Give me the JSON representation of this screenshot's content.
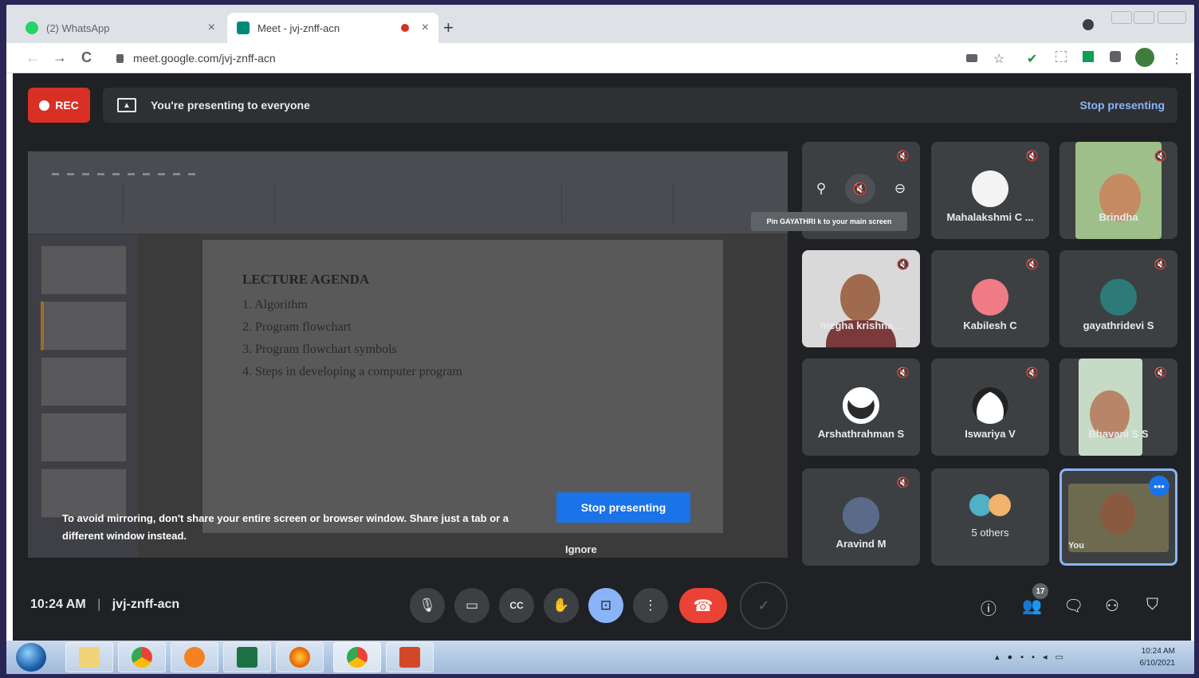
{
  "browser": {
    "tabs": [
      {
        "title": "(2) WhatsApp",
        "active": false,
        "favicon_color": "#25d366"
      },
      {
        "title": "Meet - jvj-znff-acn",
        "active": true,
        "favicon_color": "#00897b"
      }
    ],
    "close_glyph": "×",
    "newtab_glyph": "+",
    "url": "meet.google.com/jvj-znff-acn",
    "nav": {
      "back": "←",
      "forward": "→",
      "reload": "C"
    },
    "toolbar_icons": [
      "cast-icon",
      "star-icon",
      "check-icon",
      "extension-icon",
      "sheets-icon",
      "puzzle-icon",
      "profile-icon",
      "menu-icon"
    ],
    "star_glyph": "☆",
    "check_glyph": "✔",
    "menu_glyph": "⋮"
  },
  "meet": {
    "rec_label": "REC",
    "presenting_banner": "You're presenting to everyone",
    "stop_presenting_link": "Stop presenting",
    "shared_screen": {
      "slide_title": "LECTURE AGENDA",
      "agenda": [
        "1.   Algorithm",
        "2.   Program flowchart",
        "3.   Program flowchart symbols",
        "4.   Steps in developing a computer program"
      ]
    },
    "mirror_warning": "To avoid mirroring, don't share your entire screen or browser window. Share just a tab or a different window instead.",
    "stop_presenting_button": "Stop presenting",
    "ignore_button": "Ignore",
    "pin_tooltip": "Pin GAYATHRI k to your main screen",
    "participants": [
      {
        "name": "GAYATHRI k",
        "type": "pin-hover"
      },
      {
        "name": "Mahalakshmi C ...",
        "type": "avatar",
        "avatar_color": "#f4f4f4"
      },
      {
        "name": "Brindha",
        "type": "video",
        "bg": "#9fbf8a",
        "face": "#c58a62"
      },
      {
        "name": "megha krishna...",
        "type": "video",
        "bg": "#d9d9d9",
        "face": "#a06a4f"
      },
      {
        "name": "Kabilesh C",
        "type": "avatar",
        "avatar_color": "#ee7b86"
      },
      {
        "name": "gayathridevi S",
        "type": "avatar",
        "avatar_color": "#2c7b78"
      },
      {
        "name": "Arshathrahman S",
        "type": "avatar",
        "avatar_color": "#ffffff"
      },
      {
        "name": "Iswariya V",
        "type": "avatar",
        "avatar_color": "#ffffff"
      },
      {
        "name": "Bhavani S S",
        "type": "video",
        "bg": "#c6dbc6",
        "face": "#b88568"
      },
      {
        "name": "Aravind M",
        "type": "avatar",
        "avatar_color": "#5a6b8a"
      },
      {
        "name": "5 others",
        "type": "others"
      },
      {
        "name": "You",
        "type": "self",
        "bg": "#6e6a50",
        "face": "#8a5a40"
      }
    ],
    "time": "10:24 AM",
    "separator": "|",
    "meeting_code": "jvj-znff-acn",
    "people_count": "17",
    "controls": {
      "mic_glyph": "🎙",
      "camera_glyph": "▭",
      "captions_glyph": "CC",
      "raise_hand_glyph": "✋",
      "present_glyph": "⊡",
      "more_glyph": "⋮",
      "hangup_glyph": "☎",
      "info_glyph": "ⓘ",
      "people_glyph": "👥",
      "chat_glyph": "🗨",
      "activities_glyph": "⚇",
      "safety_glyph": "⛉",
      "check_glyph": "✓",
      "pin_glyph": "⚲",
      "remove_glyph": "⊖",
      "muted_glyph": "🔇",
      "more_dots": "•••"
    }
  },
  "taskbar": {
    "apps": [
      "windows-explorer",
      "chrome",
      "media-player",
      "excel",
      "firefox",
      "chrome-active",
      "powerpoint"
    ],
    "clock_time": "10:24 AM",
    "clock_date": "6/10/2021"
  }
}
